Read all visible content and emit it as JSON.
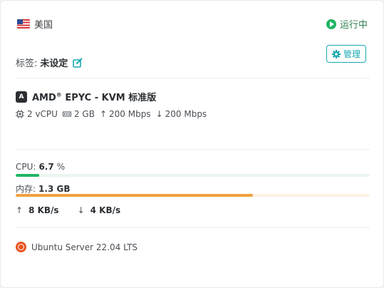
{
  "region": {
    "flag_icon": "us-flag-icon",
    "name": "美国"
  },
  "status": {
    "label": "运行中",
    "color": "#20b463"
  },
  "tags": {
    "label": "标签:",
    "value": "未设定"
  },
  "manage_button": {
    "label": "管理"
  },
  "server": {
    "cpu_badge": "A",
    "cpu_name": "AMD",
    "cpu_sup": "®",
    "cpu_rest": " EPYC - KVM 标准版",
    "specs": [
      {
        "icon": "cpu-chip-icon",
        "value": "2 vCPU"
      },
      {
        "icon": "memory-icon",
        "value": "2 GB"
      },
      {
        "icon": "arrow-up-icon",
        "value": "200 Mbps"
      },
      {
        "icon": "arrow-down-icon",
        "value": "200 Mbps"
      }
    ]
  },
  "usage": {
    "cpu": {
      "label": "CPU:",
      "value": "6.7",
      "unit": "%",
      "fraction": 0.067,
      "color": "#20b463"
    },
    "memory": {
      "label": "内存:",
      "value": "1.3 GB",
      "fraction": 0.67,
      "color": "#f2a041",
      "track_color": "#fdf1e3"
    }
  },
  "network": {
    "up": {
      "icon": "arrow-up-icon",
      "value": "8 KB/s"
    },
    "down": {
      "icon": "arrow-down-icon",
      "value": "4 KB/s"
    }
  },
  "os": {
    "icon": "ubuntu-icon",
    "name": "Ubuntu Server 22.04 LTS"
  }
}
